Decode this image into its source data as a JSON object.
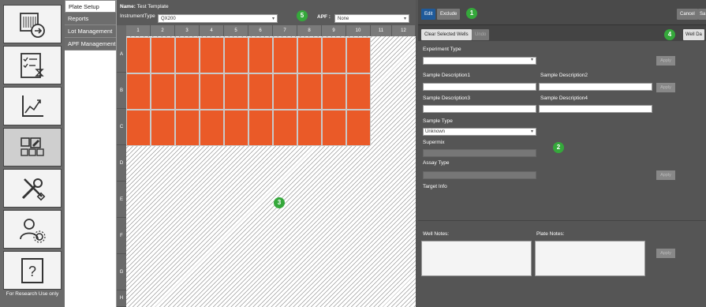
{
  "nav": {
    "items": [
      {
        "icon": "plate-export-icon"
      },
      {
        "icon": "checklist-timer-icon"
      },
      {
        "icon": "chart-line-icon"
      },
      {
        "icon": "plate-edit-icon"
      },
      {
        "icon": "tools-icon"
      },
      {
        "icon": "user-settings-icon"
      },
      {
        "icon": "help-icon",
        "label": "?"
      }
    ],
    "research_label": "For Research Use only"
  },
  "submenu": {
    "items": [
      "Plate Setup",
      "Reports",
      "Lot Management",
      "APF Management"
    ],
    "active": 0
  },
  "plate": {
    "name_label": "Name:",
    "name_value": "Test Template",
    "instrument_label": "InstrumentType",
    "instrument_value": "QX200",
    "apf_label": "APF :",
    "apf_value": "None",
    "columns": [
      "1",
      "2",
      "3",
      "4",
      "5",
      "6",
      "7",
      "8",
      "9",
      "10",
      "11",
      "12"
    ],
    "rows": [
      "A",
      "B",
      "C",
      "D",
      "E",
      "F",
      "G",
      "H"
    ],
    "filled_rows": 3,
    "filled_cols": 10,
    "well_color": "#ea5a28"
  },
  "badges": {
    "b1": "1",
    "b2": "2",
    "b3": "3",
    "b4": "4",
    "b5": "5"
  },
  "right": {
    "edit_label": "Edit",
    "exclude_label": "Exclude",
    "cancel_label": "Cancel",
    "save_label": "Sa",
    "clear_label": "Clear Selected Wells",
    "undo_label": "Undo",
    "welldata_label": "Well Da",
    "experiment_type_label": "Experiment Type",
    "sample_desc1_label": "Sample Description1",
    "sample_desc2_label": "Sample Description2",
    "sample_desc3_label": "Sample Description3",
    "sample_desc4_label": "Sample Description4",
    "sample_type_label": "Sample Type",
    "sample_type_value": "Unknown",
    "supermix_label": "Supermix",
    "assay_type_label": "Assay Type",
    "target_info_label": "Target Info",
    "well_notes_label": "Well Notes:",
    "plate_notes_label": "Plate Notes:",
    "apply_label": "Apply"
  }
}
